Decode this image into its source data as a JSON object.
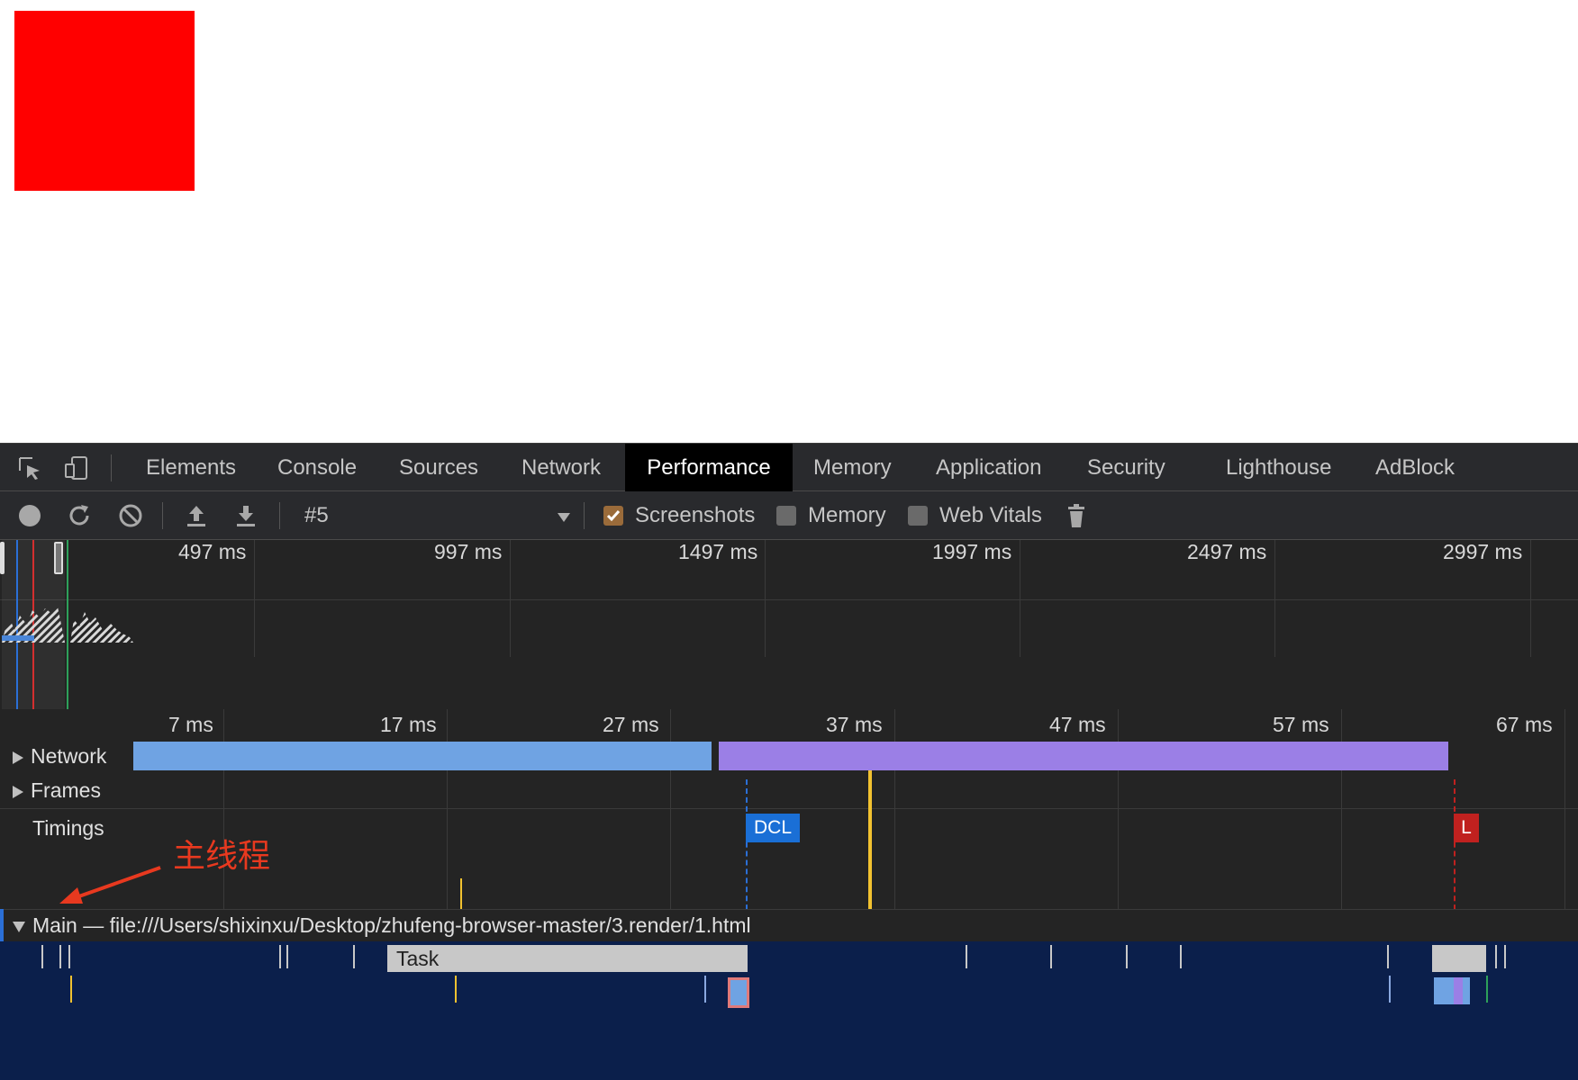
{
  "devtools_tabs": [
    "Elements",
    "Console",
    "Sources",
    "Network",
    "Performance",
    "Memory",
    "Application",
    "Security",
    "Lighthouse",
    "AdBlock"
  ],
  "active_tab": "Performance",
  "toolbar": {
    "recording_selector": "#5",
    "screenshots_label": "Screenshots",
    "screenshots_checked": true,
    "memory_label": "Memory",
    "memory_checked": false,
    "web_vitals_label": "Web Vitals",
    "web_vitals_checked": false
  },
  "overview": {
    "ticks": [
      "497 ms",
      "997 ms",
      "1497 ms",
      "1997 ms",
      "2497 ms",
      "2997 ms"
    ]
  },
  "flamechart": {
    "ticks": [
      "7 ms",
      "17 ms",
      "27 ms",
      "37 ms",
      "47 ms",
      "57 ms",
      "67 ms"
    ],
    "tracks": {
      "network": "Network",
      "frames": "Frames",
      "timings": "Timings"
    },
    "markers": {
      "dcl": "DCL",
      "load": "L"
    },
    "main_title": "Main — file:///Users/shixinxu/Desktop/zhufeng-browser-master/3.render/1.html",
    "task_label": "Task"
  },
  "annotation": {
    "text": "主线程",
    "color": "#e8391f"
  },
  "colors": {
    "network_blue": "#6fa3e3",
    "network_purple": "#9b7fe6",
    "dcl": "#1a6fd6",
    "load": "#c0211f",
    "yellow_line": "#f2c230",
    "main_bg": "#0b1f4b"
  }
}
